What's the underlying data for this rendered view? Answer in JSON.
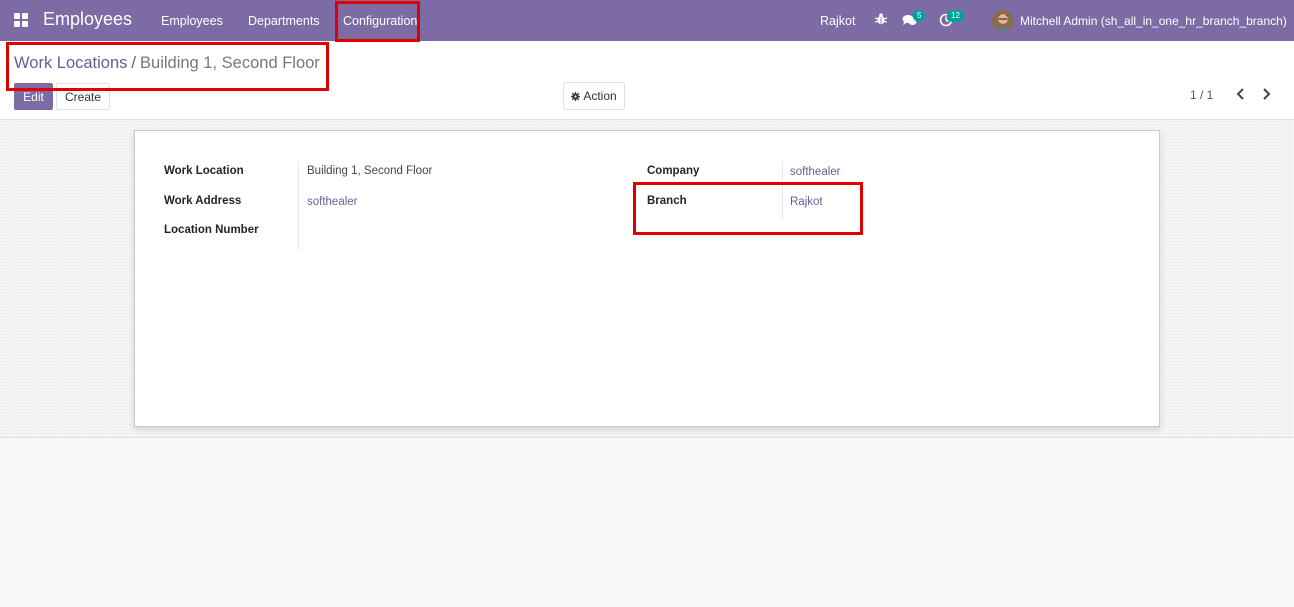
{
  "navbar": {
    "app_title": "Employees",
    "menu": [
      {
        "label": "Employees"
      },
      {
        "label": "Departments"
      },
      {
        "label": "Configuration"
      }
    ],
    "branch": "Rajkot",
    "chat_count": "5",
    "activity_count": "12",
    "user_name": "Mitchell Admin (sh_all_in_one_hr_branch_branch)"
  },
  "breadcrumb": {
    "parent": "Work Locations",
    "separator": "/",
    "current": "Building 1, Second Floor"
  },
  "toolbar": {
    "edit_label": "Edit",
    "create_label": "Create",
    "action_label": "Action"
  },
  "pager": {
    "value": "1 / 1"
  },
  "form": {
    "work_location_label": "Work Location",
    "work_location_value": "Building 1, Second Floor",
    "work_address_label": "Work Address",
    "work_address_value": "softhealer",
    "location_number_label": "Location Number",
    "location_number_value": "",
    "company_label": "Company",
    "company_value": "softhealer",
    "branch_label": "Branch",
    "branch_value": "Rajkot"
  },
  "colors": {
    "navbar": "#7c6ba5",
    "link": "#6a5c93",
    "badge": "#00a09d",
    "annotation": "#e00000"
  }
}
